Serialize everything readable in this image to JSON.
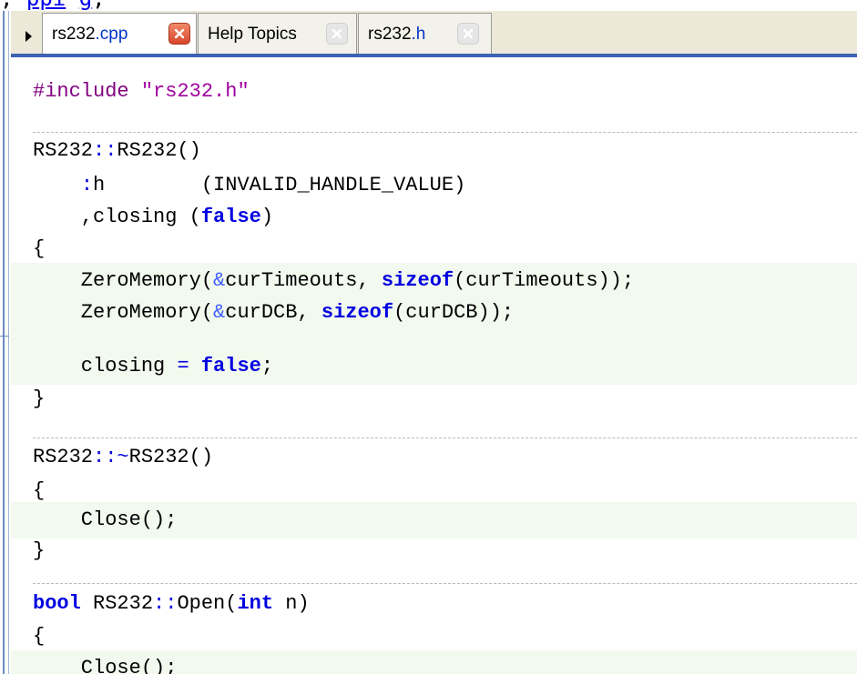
{
  "top_fragment": {
    "prefix": ", ",
    "link_text": "ppi",
    "middle": " ",
    "link_text_2": "g",
    "suffix": ",  "
  },
  "tabs": {
    "scroll_arrow_icon": "triangle-right-icon",
    "items": [
      {
        "name": "rs232",
        "ext": ".cpp",
        "active": true,
        "close_icon": "close-icon",
        "close_color": "#d8462a"
      },
      {
        "name": "Help Topics",
        "ext": "",
        "active": false,
        "close_icon": "close-icon",
        "close_color": "#e6e6e6"
      },
      {
        "name": "rs232",
        "ext": ".h",
        "active": false,
        "close_icon": "close-icon",
        "close_color": "#e6e6e6"
      }
    ]
  },
  "editor": {
    "lines": [
      {
        "segments": [
          {
            "t": "pp",
            "v": "#include "
          },
          {
            "t": "str",
            "v": "\"rs232.h\""
          }
        ]
      },
      {
        "segments": [
          {
            "t": "",
            "v": "RS232"
          },
          {
            "t": "op",
            "v": "::"
          },
          {
            "t": "",
            "v": "RS232()"
          }
        ]
      },
      {
        "segments": [
          {
            "t": "",
            "v": "    "
          },
          {
            "t": "op",
            "v": ":"
          },
          {
            "t": "",
            "v": "h        (INVALID_HANDLE_VALUE)"
          }
        ]
      },
      {
        "segments": [
          {
            "t": "",
            "v": "    ,closing ("
          },
          {
            "t": "kw",
            "v": "false"
          },
          {
            "t": "",
            "v": ")"
          }
        ]
      },
      {
        "segments": [
          {
            "t": "",
            "v": "{"
          }
        ]
      },
      {
        "segments": [
          {
            "t": "",
            "v": "    ZeroMemory("
          },
          {
            "t": "amp",
            "v": "&"
          },
          {
            "t": "",
            "v": "curTimeouts, "
          },
          {
            "t": "kw",
            "v": "sizeof"
          },
          {
            "t": "",
            "v": "(curTimeouts));"
          }
        ]
      },
      {
        "segments": [
          {
            "t": "",
            "v": "    ZeroMemory("
          },
          {
            "t": "amp",
            "v": "&"
          },
          {
            "t": "",
            "v": "curDCB, "
          },
          {
            "t": "kw",
            "v": "sizeof"
          },
          {
            "t": "",
            "v": "(curDCB));"
          }
        ]
      },
      {
        "segments": [
          {
            "t": "",
            "v": ""
          }
        ]
      },
      {
        "segments": [
          {
            "t": "",
            "v": "    closing "
          },
          {
            "t": "op",
            "v": "="
          },
          {
            "t": "",
            "v": " "
          },
          {
            "t": "kw",
            "v": "false"
          },
          {
            "t": "",
            "v": ";"
          }
        ]
      },
      {
        "segments": [
          {
            "t": "",
            "v": "}"
          }
        ]
      },
      {
        "segments": [
          {
            "t": "",
            "v": "RS232"
          },
          {
            "t": "op",
            "v": "::~"
          },
          {
            "t": "",
            "v": "RS232()"
          }
        ]
      },
      {
        "segments": [
          {
            "t": "",
            "v": "{"
          }
        ]
      },
      {
        "segments": [
          {
            "t": "",
            "v": "    Close();"
          }
        ]
      },
      {
        "segments": [
          {
            "t": "",
            "v": "}"
          }
        ]
      },
      {
        "segments": [
          {
            "t": "kw",
            "v": "bool"
          },
          {
            "t": "",
            "v": " RS232"
          },
          {
            "t": "op",
            "v": "::"
          },
          {
            "t": "",
            "v": "Open("
          },
          {
            "t": "kw",
            "v": "int"
          },
          {
            "t": "",
            "v": " n)"
          }
        ]
      },
      {
        "segments": [
          {
            "t": "",
            "v": "{"
          }
        ]
      },
      {
        "segments": [
          {
            "t": "",
            "v": "    Close();"
          }
        ]
      }
    ]
  }
}
